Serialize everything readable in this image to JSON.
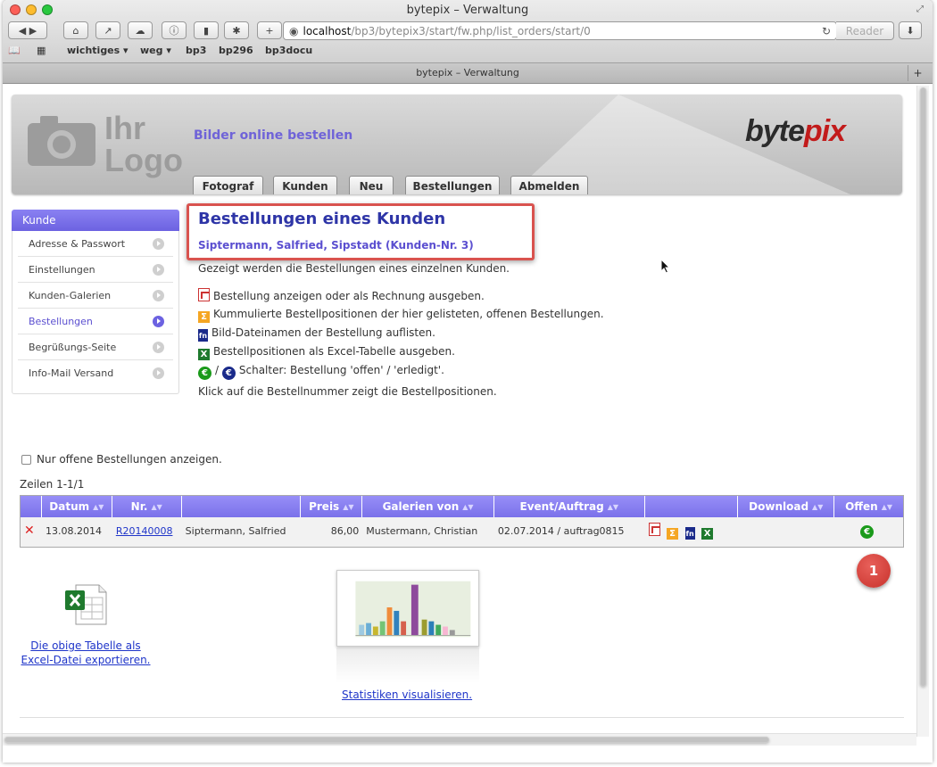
{
  "window": {
    "title": "bytepix – Verwaltung",
    "tab_title": "bytepix – Verwaltung"
  },
  "toolbar": {
    "url_host": "localhost",
    "url_path": "/bp3/bytepix3/start/fw.php/list_orders/start/0",
    "reader_label": "Reader",
    "bookmarks": [
      "wichtiges ▾",
      "weg ▾",
      "bp3",
      "bp296",
      "bp3docu"
    ]
  },
  "header": {
    "logo_line1": "Ihr",
    "logo_line2": "Logo",
    "slogan": "Bilder online bestellen",
    "brand_a": "byte",
    "brand_b": "pix",
    "nav": [
      "Fotograf",
      "Kunden",
      "Neu",
      "Bestellungen",
      "Abmelden"
    ]
  },
  "sidebar": {
    "title": "Kunde",
    "items": [
      "Adresse & Passwort",
      "Einstellungen",
      "Kunden-Galerien",
      "Bestellungen",
      "Begrüßungs-Seite",
      "Info-Mail Versand"
    ],
    "active_index": 3
  },
  "main": {
    "heading": "Bestellungen eines Kunden",
    "subheading": "Siptermann, Salfried, Sipstadt (Kunden-Nr. 3)",
    "intro": "Gezeigt werden die Bestellungen eines einzelnen Kunden.",
    "legend_pdf": "Bestellung anzeigen oder als Rechnung ausgeben.",
    "legend_sigma": "Kummulierte Bestellpositionen der hier gelisteten, offenen Bestellungen.",
    "legend_fn": "Bild-Dateinamen der Bestellung auflisten.",
    "legend_xls": "Bestellpositionen als Excel-Tabelle ausgeben.",
    "legend_switch": "Schalter: Bestellung 'offen' / 'erledigt'.",
    "legend_switch_sep": "/",
    "legend_click": "Klick auf die Bestellnummer zeigt die Bestellpositionen.",
    "checkbox_label": "Nur offene Bestellungen anzeigen.",
    "rows_info": "Zeilen 1-1/1"
  },
  "table": {
    "columns": [
      "",
      "Datum",
      "Nr.",
      "",
      "Preis",
      "Galerien von",
      "Event/Auftrag",
      "",
      "Download",
      "Offen"
    ],
    "rows": [
      {
        "date": "13.08.2014",
        "nr": "R20140008",
        "customer": "Siptermann, Salfried",
        "price": "86,00",
        "gallery": "Mustermann, Christian",
        "event": "02.07.2014 / auftrag0815"
      }
    ]
  },
  "badge": "1",
  "export_link": "Die obige Tabelle als Excel-Datei exportieren.",
  "stats_link": "Statistiken visualisieren.",
  "icons": {
    "pdf": "pdf-icon",
    "sigma": "sigma-icon",
    "fn": "filename-icon",
    "xls": "excel-icon",
    "euro_green": "euro-open-icon",
    "euro_blue": "euro-done-icon",
    "delete": "delete-icon"
  },
  "colors": {
    "accent": "#7a71ea",
    "heading": "#2e35a7",
    "highlight": "#d9534f",
    "link": "#1f35c9"
  }
}
